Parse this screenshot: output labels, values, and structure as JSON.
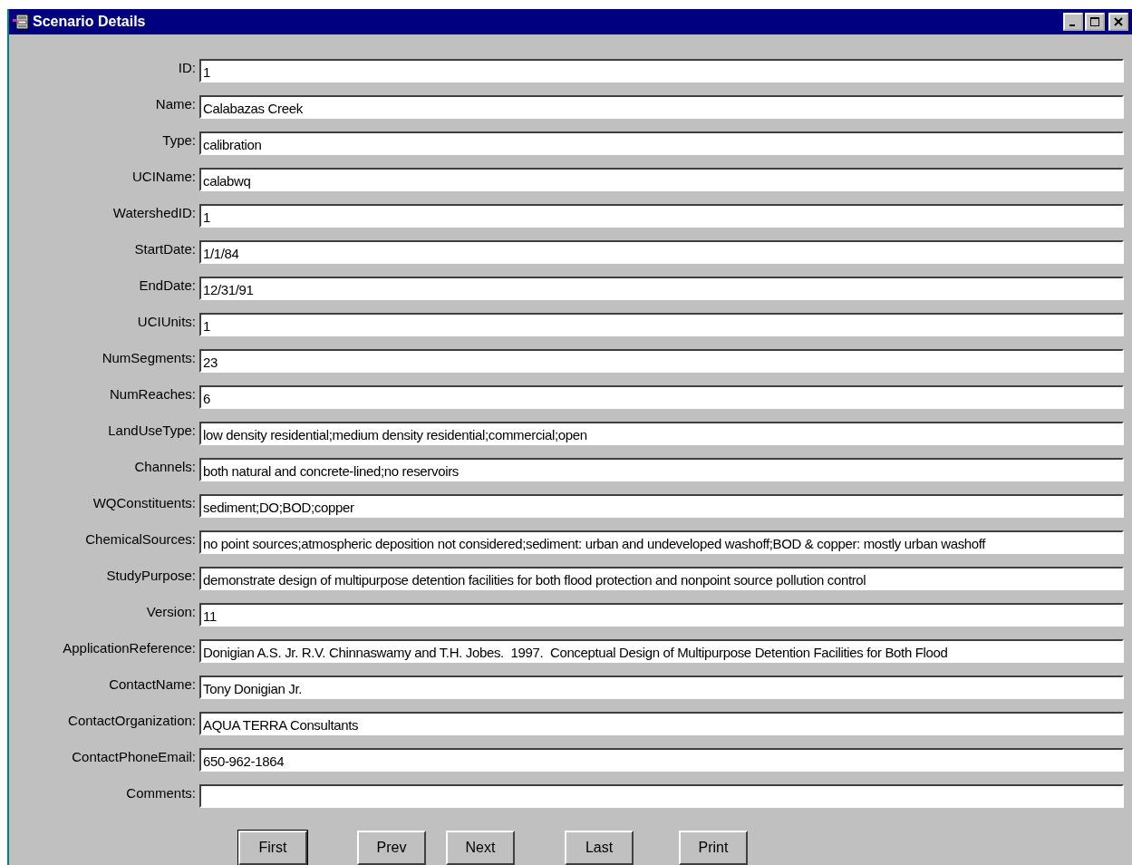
{
  "window": {
    "title": "Scenario Details"
  },
  "fields": [
    {
      "label": "ID:",
      "value": "1"
    },
    {
      "label": "Name:",
      "value": "Calabazas Creek"
    },
    {
      "label": "Type:",
      "value": "calibration"
    },
    {
      "label": "UCIName:",
      "value": "calabwq"
    },
    {
      "label": "WatershedID:",
      "value": "1"
    },
    {
      "label": "StartDate:",
      "value": "1/1/84"
    },
    {
      "label": "EndDate:",
      "value": "12/31/91"
    },
    {
      "label": "UCIUnits:",
      "value": "1"
    },
    {
      "label": "NumSegments:",
      "value": "23"
    },
    {
      "label": "NumReaches:",
      "value": "6"
    },
    {
      "label": "LandUseType:",
      "value": "low density residential;medium density residential;commercial;open"
    },
    {
      "label": "Channels:",
      "value": "both natural and concrete-lined;no reservoirs"
    },
    {
      "label": "WQConstituents:",
      "value": "sediment;DO;BOD;copper"
    },
    {
      "label": "ChemicalSources:",
      "value": "no point sources;atmospheric deposition not considered;sediment: urban and undeveloped washoff;BOD & copper: mostly urban washoff"
    },
    {
      "label": "StudyPurpose:",
      "value": "demonstrate design of multipurpose detention facilities for both flood protection and nonpoint source pollution control"
    },
    {
      "label": "Version:",
      "value": "11"
    },
    {
      "label": "ApplicationReference:",
      "value": "Donigian A.S. Jr. R.V. Chinnaswamy and T.H. Jobes.  1997.  Conceptual Design of Multipurpose Detention Facilities for Both Flood"
    },
    {
      "label": "ContactName:",
      "value": "Tony Donigian Jr."
    },
    {
      "label": "ContactOrganization:",
      "value": "AQUA TERRA Consultants"
    },
    {
      "label": "ContactPhoneEmail:",
      "value": "650-962-1864"
    },
    {
      "label": "Comments:"
    }
  ],
  "buttons": [
    {
      "label": "First",
      "default": true
    },
    {
      "label": "Prev",
      "default": false
    },
    {
      "label": "Next",
      "default": false
    },
    {
      "label": "Last",
      "default": false
    },
    {
      "label": "Print",
      "default": false
    }
  ]
}
